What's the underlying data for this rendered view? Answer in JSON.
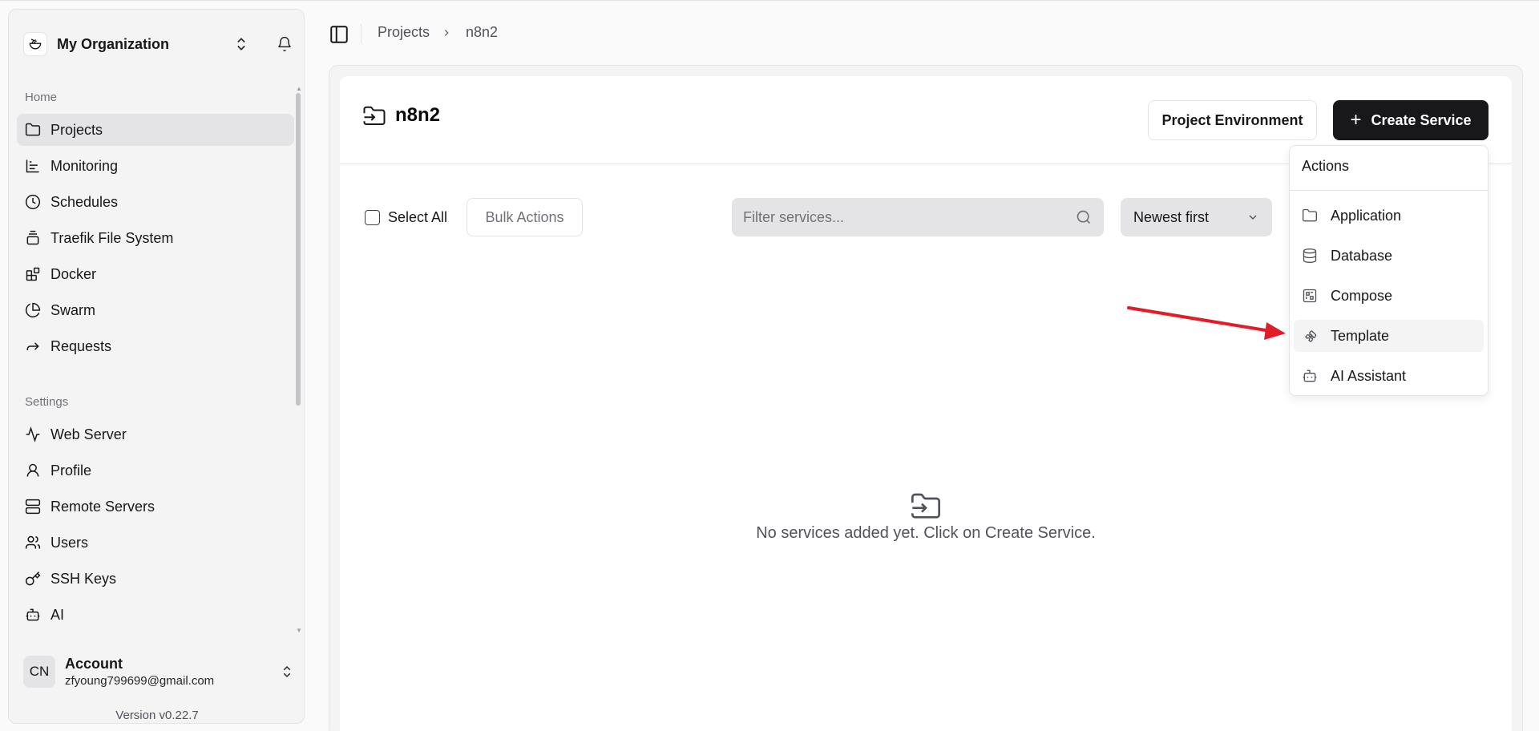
{
  "org": {
    "name": "My Organization"
  },
  "sidebar": {
    "home_label": "Home",
    "home_items": [
      {
        "label": "Projects",
        "icon": "folder-icon"
      },
      {
        "label": "Monitoring",
        "icon": "chart-icon"
      },
      {
        "label": "Schedules",
        "icon": "clock-icon"
      },
      {
        "label": "Traefik File System",
        "icon": "stack-icon"
      },
      {
        "label": "Docker",
        "icon": "blocks-icon"
      },
      {
        "label": "Swarm",
        "icon": "pie-icon"
      },
      {
        "label": "Requests",
        "icon": "forward-icon"
      }
    ],
    "settings_label": "Settings",
    "settings_items": [
      {
        "label": "Web Server",
        "icon": "activity-icon"
      },
      {
        "label": "Profile",
        "icon": "user-icon"
      },
      {
        "label": "Remote Servers",
        "icon": "server-icon"
      },
      {
        "label": "Users",
        "icon": "users-icon"
      },
      {
        "label": "SSH Keys",
        "icon": "key-icon"
      },
      {
        "label": "AI",
        "icon": "bot-icon"
      }
    ]
  },
  "account": {
    "initials": "CN",
    "name": "Account",
    "email": "zfyoung799699@gmail.com",
    "version": "Version v0.22.7"
  },
  "breadcrumb": {
    "root": "Projects",
    "current": "n8n2"
  },
  "project": {
    "title": "n8n2"
  },
  "buttons": {
    "environment": "Project Environment",
    "create": "Create Service"
  },
  "toolbar": {
    "select_all": "Select All",
    "bulk_actions": "Bulk Actions",
    "filter_placeholder": "Filter services...",
    "sort_value": "Newest first"
  },
  "empty_state": {
    "message": "No services added yet. Click on Create Service."
  },
  "menu": {
    "label": "Actions",
    "items": [
      {
        "label": "Application",
        "icon": "folder-icon"
      },
      {
        "label": "Database",
        "icon": "database-icon"
      },
      {
        "label": "Compose",
        "icon": "compose-icon"
      },
      {
        "label": "Template",
        "icon": "puzzle-icon"
      },
      {
        "label": "AI Assistant",
        "icon": "bot-icon"
      }
    ]
  },
  "colors": {
    "annotation_arrow": "#e11d2a",
    "primary_button": "#18181b"
  }
}
